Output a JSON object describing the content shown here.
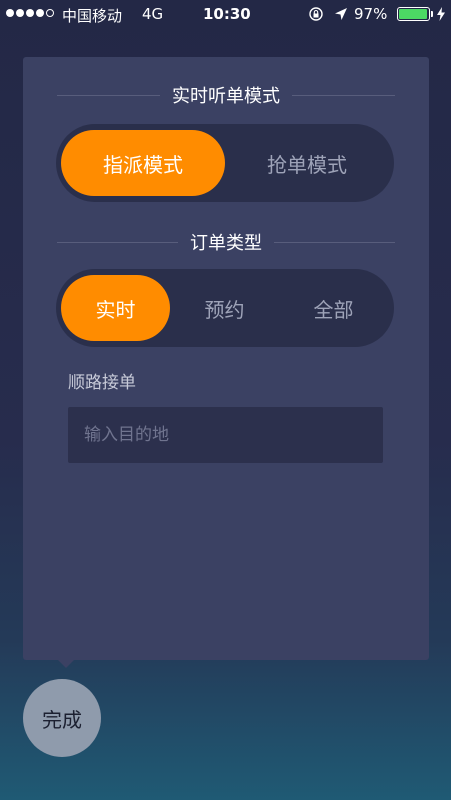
{
  "status_bar": {
    "carrier": "中国移动",
    "network": "4G",
    "time": "10:30",
    "battery_pct": "97%",
    "battery_level": 0.97,
    "signal_bars_filled": 4,
    "signal_bars_total": 5
  },
  "panel": {
    "listen_mode": {
      "heading": "实时听单模式",
      "options": [
        "指派模式",
        "抢单模式"
      ],
      "selected": "指派模式"
    },
    "order_type": {
      "heading": "订单类型",
      "options": [
        "实时",
        "预约",
        "全部"
      ],
      "selected": "实时"
    },
    "route_order": {
      "label": "顺路接单",
      "placeholder": "输入目的地",
      "value": ""
    }
  },
  "done_button": {
    "label": "完成"
  },
  "colors": {
    "accent": "#ff8c00",
    "panel": "#3b4163",
    "battery": "#4cd964"
  }
}
